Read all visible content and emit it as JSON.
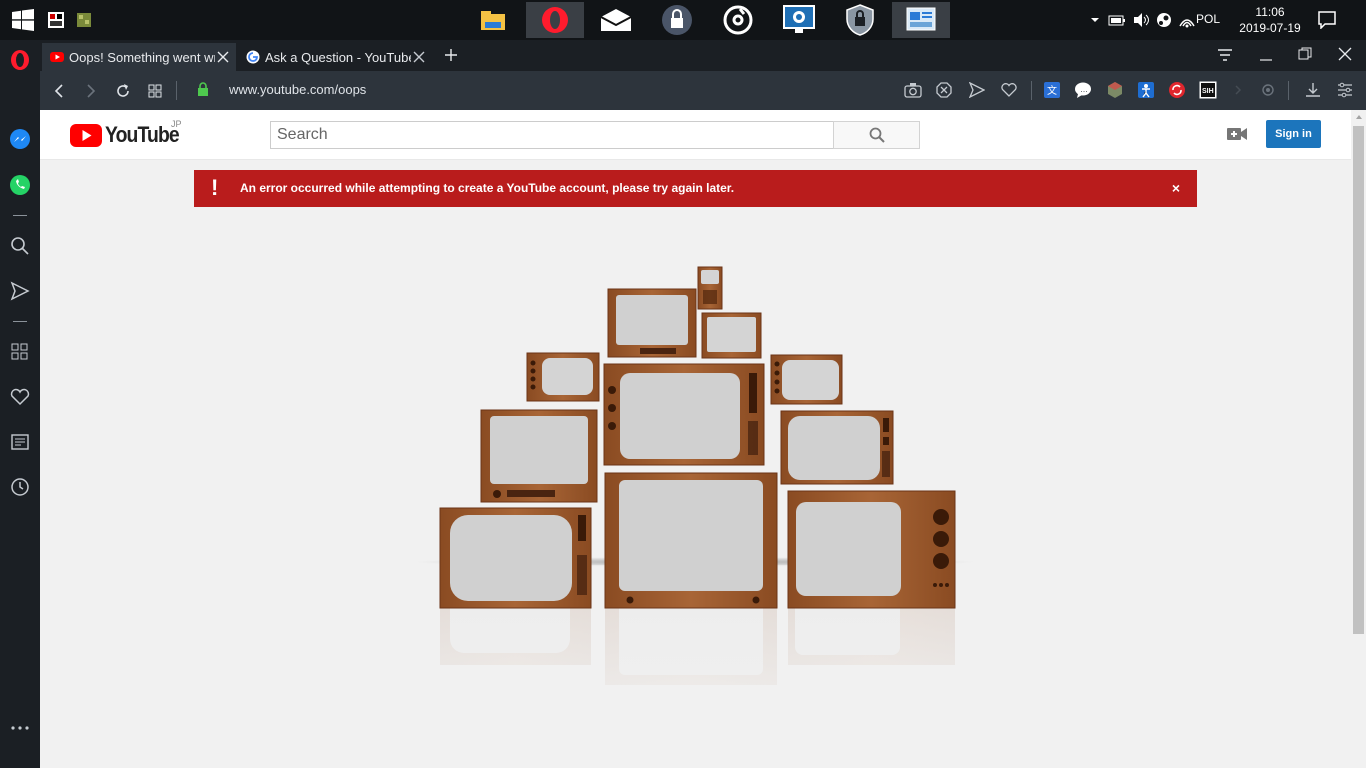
{
  "taskbar": {
    "tray": {
      "language": "POL",
      "time": "11:06",
      "date": "2019-07-19"
    }
  },
  "tabs": [
    {
      "title": "Oops! Something went wro",
      "favicon": "youtube-icon",
      "active": true
    },
    {
      "title": "Ask a Question - YouTube H",
      "favicon": "google-icon",
      "active": false
    }
  ],
  "address": {
    "url": "www.youtube.com/oops"
  },
  "youtube": {
    "region": "JP",
    "logo_text": "YouTube",
    "search_placeholder": "Search",
    "signin_label": "Sign in",
    "error_message": "An error occurred while attempting to create a YouTube account, please try again later.",
    "error_icon": "!",
    "close_glyph": "×"
  },
  "colors": {
    "error_bg": "#b91c1c",
    "signin_bg": "#1c75bc",
    "youtube_red": "#ff0000",
    "tv_wood": "#9a5a2c"
  }
}
